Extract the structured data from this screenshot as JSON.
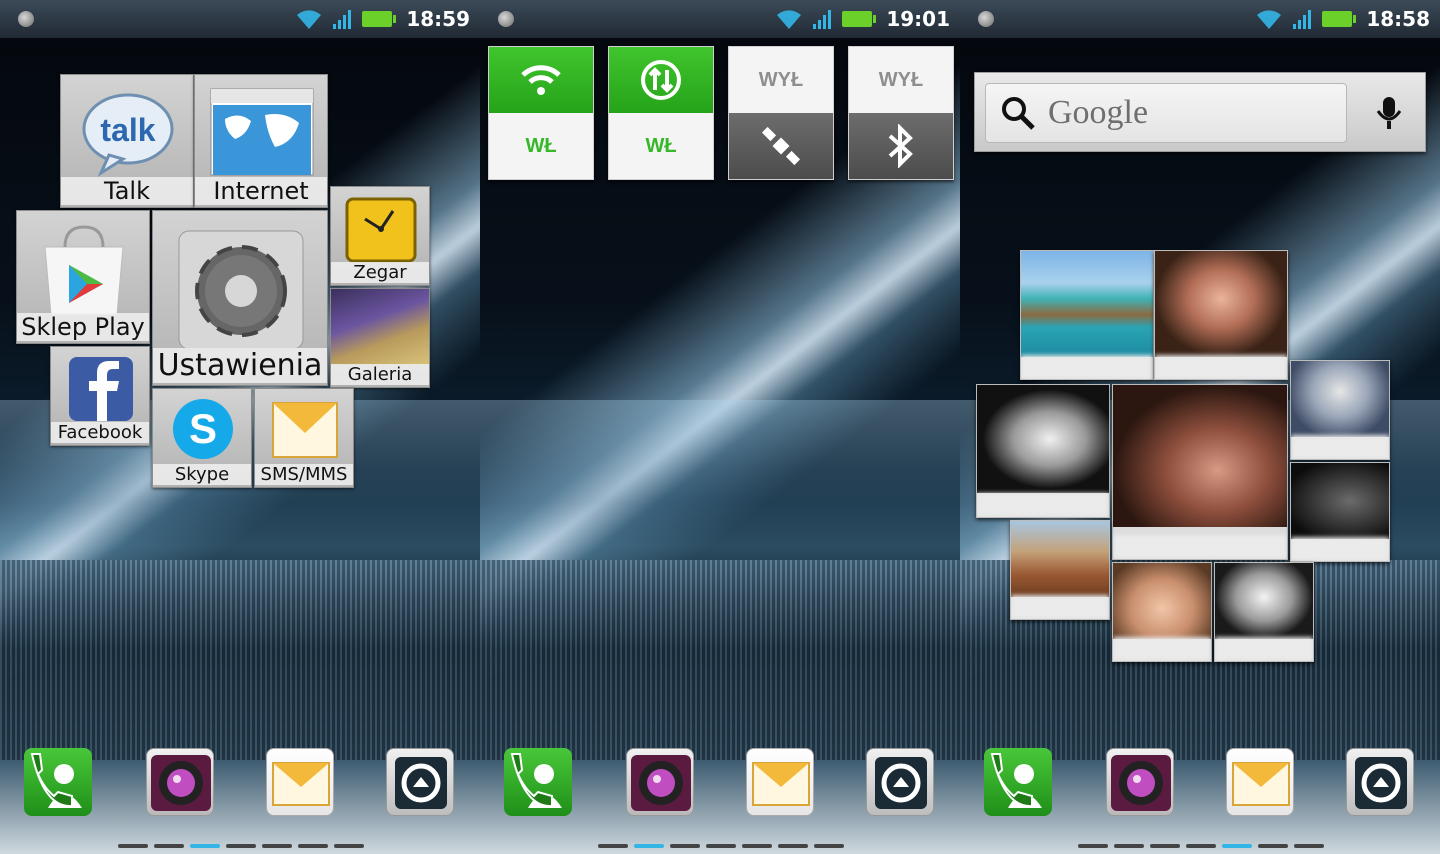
{
  "screens": [
    {
      "status": {
        "time": "19:01"
      },
      "power_control": [
        {
          "label": "WŁ",
          "state": "on",
          "icon": "wifi-icon"
        },
        {
          "label": "WŁ",
          "state": "on",
          "icon": "data-sync-icon"
        },
        {
          "label": "WYŁ",
          "state": "off",
          "icon": "gps-satellite-icon"
        },
        {
          "label": "WYŁ",
          "state": "off",
          "icon": "bluetooth-icon"
        }
      ],
      "active_page": 1
    },
    {
      "status": {
        "time": "18:58"
      },
      "search": {
        "placeholder": "Google"
      },
      "active_page": 4
    },
    {
      "status": {
        "time": "18:59"
      },
      "apps": {
        "talk": "Talk",
        "internet": "Internet",
        "clock": "Zegar",
        "play": "Sklep Play",
        "settings": "Ustawienia",
        "gallery": "Galeria",
        "facebook": "Facebook",
        "skype": "Skype",
        "sms": "SMS/MMS"
      },
      "active_page": 2
    }
  ],
  "dock": [
    "phone-contacts-icon",
    "camera-icon",
    "messaging-icon",
    "app-drawer-icon"
  ],
  "colors": {
    "accent": "#33b5e5",
    "on_green": "#36b82a",
    "off_gray": "#8e8e8e"
  }
}
